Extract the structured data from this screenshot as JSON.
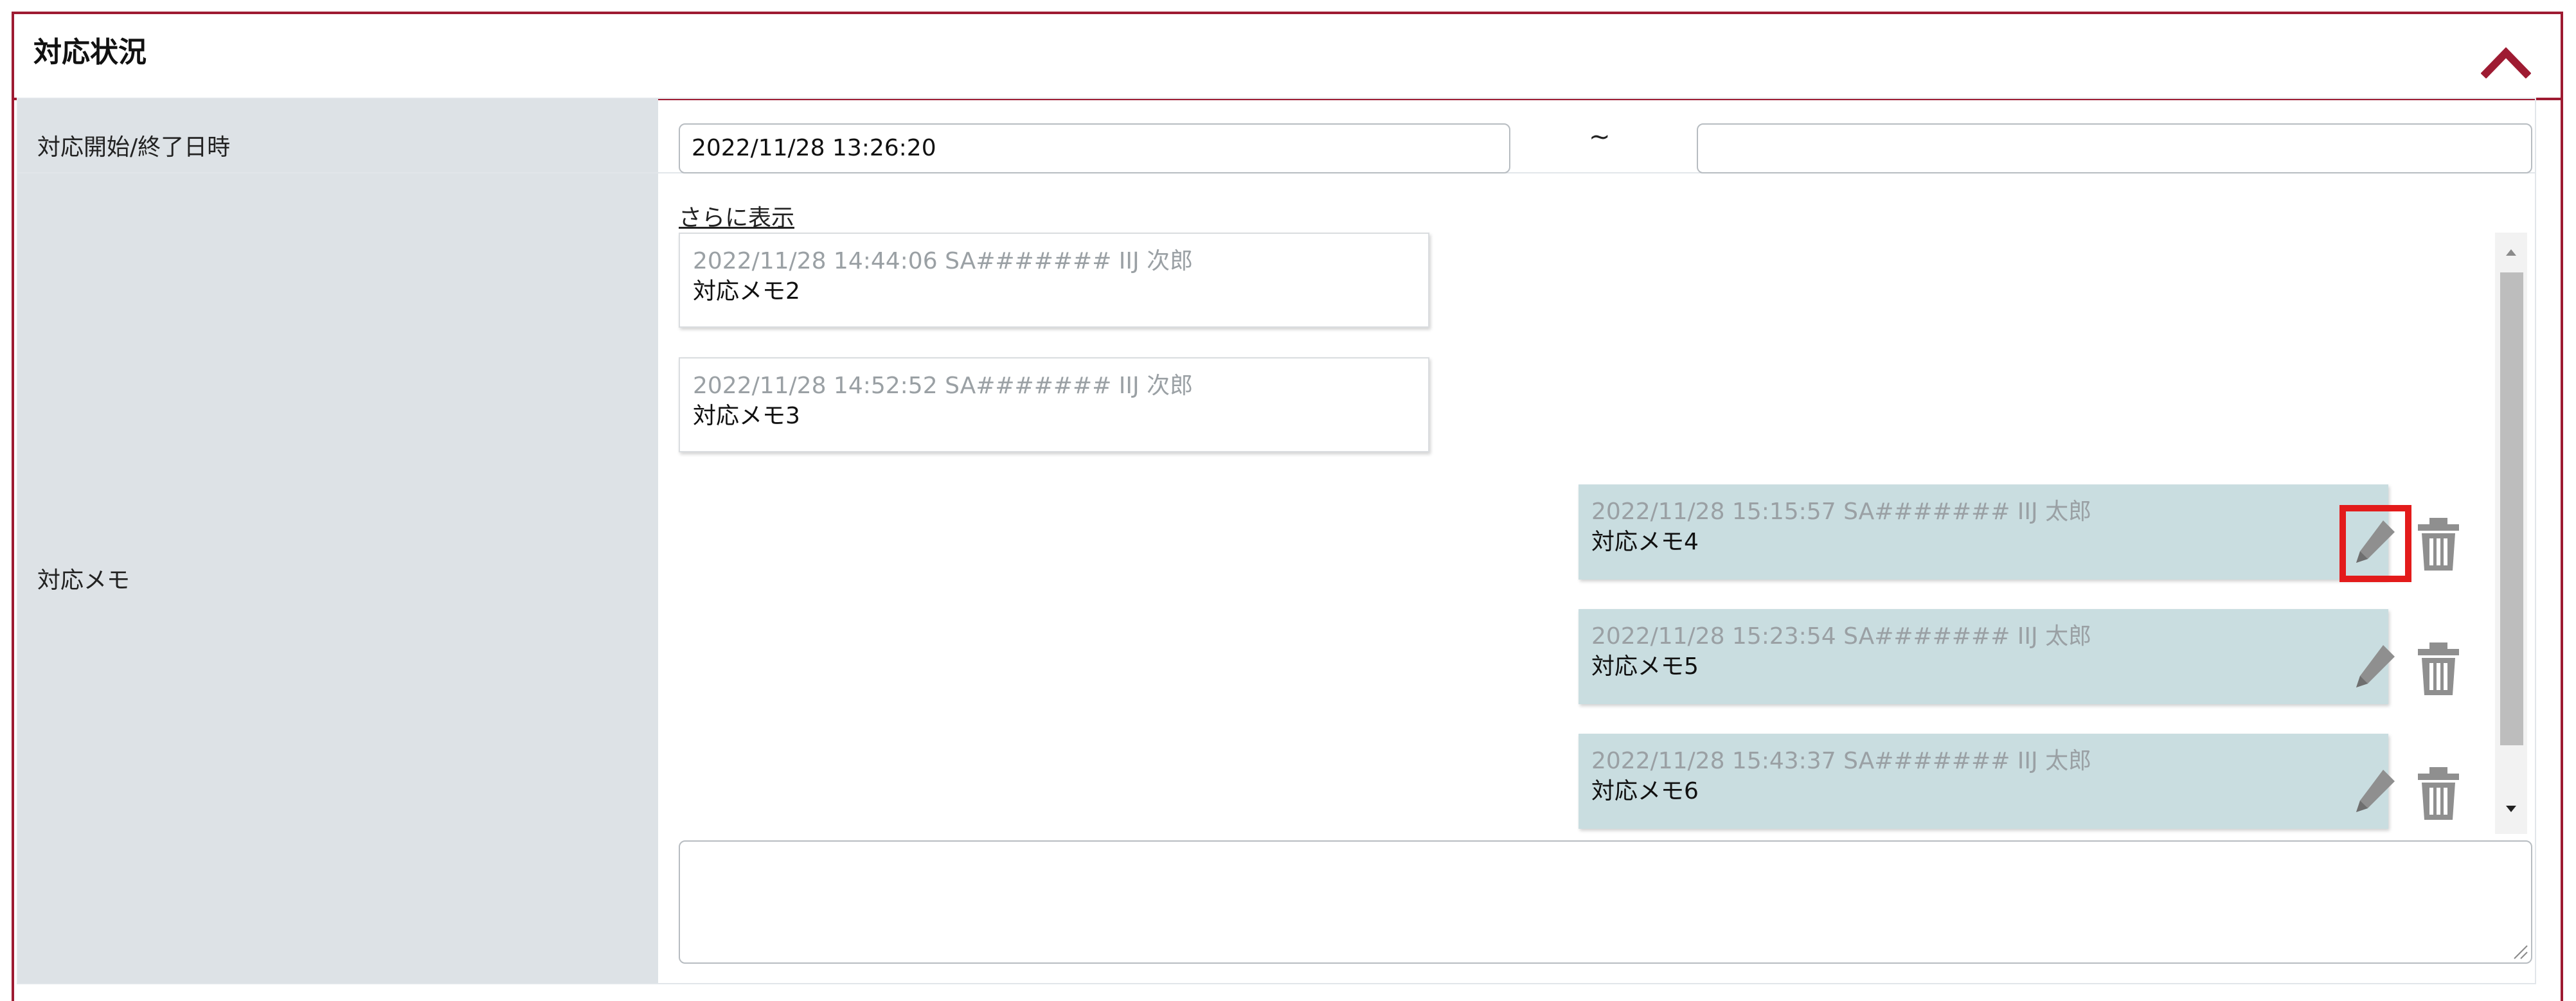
{
  "panel": {
    "title": "対応状況",
    "accent_color": "#9e1b32"
  },
  "fields": {
    "period": {
      "label": "対応開始/終了日時",
      "start_value": "2022/11/28 13:26:20",
      "separator": "~",
      "end_value": ""
    },
    "memo": {
      "label": "対応メモ",
      "show_more_label": "さらに表示",
      "entries": [
        {
          "meta": "2022/11/28 14:44:06  SA####### IIJ 次郎",
          "text": "対応メモ2",
          "side": "left"
        },
        {
          "meta": "2022/11/28 14:52:52  SA####### IIJ 次郎",
          "text": "対応メモ3",
          "side": "left"
        },
        {
          "meta": "2022/11/28 15:15:57  SA####### IIJ 太郎",
          "text": "対応メモ4",
          "side": "right"
        },
        {
          "meta": "2022/11/28 15:23:54  SA####### IIJ 太郎",
          "text": "対応メモ5",
          "side": "right"
        },
        {
          "meta": "2022/11/28 15:43:37  SA####### IIJ 太郎",
          "text": "対応メモ6",
          "side": "right"
        }
      ],
      "input_value": ""
    }
  },
  "icons": {
    "collapse": "chevron-up-icon",
    "edit": "pencil-icon",
    "delete": "trash-icon"
  },
  "colors": {
    "own_memo_bg": "#c9dde0",
    "highlight": "#e31b1b",
    "label_bg": "#dde2e6"
  }
}
